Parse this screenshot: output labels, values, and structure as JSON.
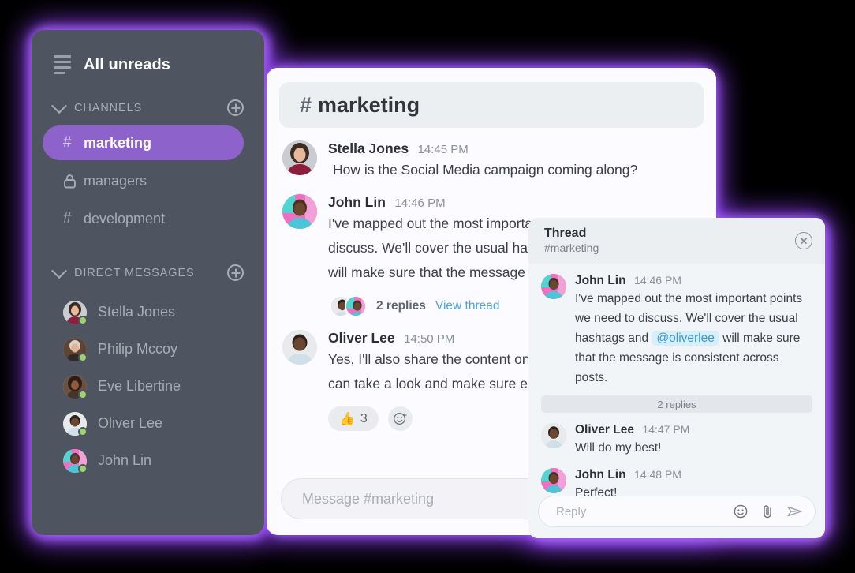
{
  "theme": {
    "glow_color": "#8b3ff0",
    "sidebar_bg": "#4f5560",
    "active_channel_bg": "#8d63cb",
    "link_color": "#4ba3e3",
    "mention_bg": "#d7eefb",
    "online_dot": "#9cd46b"
  },
  "sidebar": {
    "menu_icon": "hamburger-icon",
    "title": "All unreads",
    "channels_section": {
      "label": "CHANNELS",
      "collapse_icon": "chevron-down-icon",
      "add_icon": "plus-circle-icon",
      "items": [
        {
          "name": "marketing",
          "icon": "hash-icon",
          "active": true
        },
        {
          "name": "managers",
          "icon": "lock-icon",
          "active": false
        },
        {
          "name": "development",
          "icon": "hash-icon",
          "active": false
        }
      ]
    },
    "dm_section": {
      "label": "DIRECT MESSAGES",
      "collapse_icon": "chevron-down-icon",
      "add_icon": "plus-circle-icon",
      "items": [
        {
          "name": "Stella Jones",
          "status": "online"
        },
        {
          "name": "Philip Mccoy",
          "status": "online"
        },
        {
          "name": "Eve Libertine",
          "status": "online"
        },
        {
          "name": "Oliver Lee",
          "status": "online"
        },
        {
          "name": "John Lin",
          "status": "online"
        }
      ]
    }
  },
  "channel": {
    "hash": "#",
    "name": "marketing",
    "messages": [
      {
        "author": "Stella Jones",
        "time": "14:45 PM",
        "text": "How is the Social Media campaign coming along?"
      },
      {
        "author": "John Lin",
        "time": "14:46 PM",
        "line1": "I've mapped out the most important points we need to",
        "line2": "discuss. We'll cover the usual hashtags and @oliverlee",
        "line3": "will make sure that the message is consistent across",
        "replies_count": "2 replies",
        "view_thread": "View thread"
      },
      {
        "author": "Oliver Lee",
        "time": "14:50 PM",
        "line1": "Yes, I'll also share the content once it's ready so you",
        "line2": "can take a look and make sure everything is correct.",
        "reaction_emoji": "👍",
        "reaction_count": "3",
        "add_reaction_icon": "add-emoji-icon"
      }
    ],
    "composer": {
      "placeholder": "Message #marketing"
    }
  },
  "thread": {
    "title": "Thread",
    "subtitle": "#marketing",
    "close_icon": "close-circle-icon",
    "root": {
      "author": "John Lin",
      "time": "14:46 PM",
      "text_before": "I've mapped out the most important points we need to discuss. We'll cover the usual hashtags and ",
      "mention": "@oliverlee",
      "text_after": " will make sure that the message is consistent across posts."
    },
    "divider": "2 replies",
    "replies": [
      {
        "author": "Oliver Lee",
        "time": "14:47 PM",
        "text": "Will do my best!"
      },
      {
        "author": "John Lin",
        "time": "14:48 PM",
        "text": "Perfect!"
      }
    ],
    "composer": {
      "placeholder": "Reply",
      "emoji_icon": "emoji-icon",
      "attach_icon": "paperclip-icon",
      "send_icon": "send-icon"
    }
  }
}
